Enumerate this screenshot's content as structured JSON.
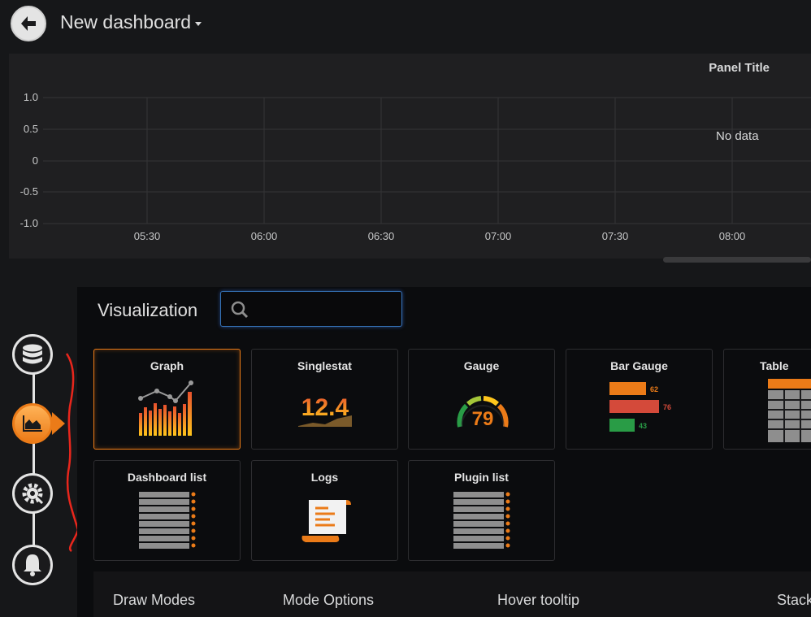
{
  "header": {
    "title": "New dashboard",
    "back_icon": "arrow-left-icon"
  },
  "panel": {
    "title": "Panel Title",
    "no_data_text": "No data",
    "y_ticks": [
      "1.0",
      "0.5",
      "0",
      "-0.5",
      "-1.0"
    ],
    "x_ticks": [
      "05:30",
      "06:00",
      "06:30",
      "07:00",
      "07:30",
      "08:00"
    ]
  },
  "sidebar": {
    "items": [
      {
        "name": "queries",
        "icon": "database-icon",
        "active": false
      },
      {
        "name": "visualization",
        "icon": "area-chart-icon",
        "active": true
      },
      {
        "name": "general",
        "icon": "gear-wrench-icon",
        "active": false
      },
      {
        "name": "alert",
        "icon": "bell-icon",
        "active": false
      }
    ]
  },
  "viz_picker": {
    "title": "Visualization",
    "search_placeholder": "",
    "cards": [
      {
        "label": "Graph",
        "selected": true
      },
      {
        "label": "Singlestat",
        "value_text": "12.4"
      },
      {
        "label": "Gauge",
        "value_text": "79"
      },
      {
        "label": "Bar Gauge",
        "bars": [
          {
            "value": "62",
            "color": "#eb7b18"
          },
          {
            "value": "76",
            "color": "#d44a3a"
          },
          {
            "value": "43",
            "color": "#299c46"
          }
        ]
      },
      {
        "label": "Table"
      },
      {
        "label": "Dashboard list"
      },
      {
        "label": "Logs"
      },
      {
        "label": "Plugin list"
      }
    ]
  },
  "options": {
    "labels": [
      "Draw Modes",
      "Mode Options",
      "Hover tooltip",
      "Stack"
    ]
  },
  "colors": {
    "accent": "#eb7b18",
    "search_border": "#3571b5",
    "annotation": "#e8261c"
  }
}
